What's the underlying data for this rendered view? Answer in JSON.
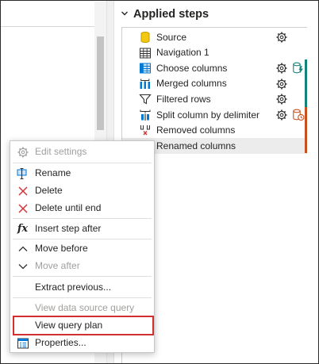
{
  "applied_steps": {
    "title": "Applied steps",
    "steps": [
      {
        "label": "Source"
      },
      {
        "label": "Navigation 1"
      },
      {
        "label": "Choose columns"
      },
      {
        "label": "Merged columns"
      },
      {
        "label": "Filtered rows"
      },
      {
        "label": "Split column by delimiter"
      },
      {
        "label": "Removed columns"
      },
      {
        "label": "Renamed columns"
      }
    ]
  },
  "context_menu": {
    "edit_settings": "Edit settings",
    "rename": "Rename",
    "delete": "Delete",
    "delete_until_end": "Delete until end",
    "insert_step_after": "Insert step after",
    "move_before": "Move before",
    "move_after": "Move after",
    "extract_previous": "Extract previous...",
    "view_data_source_query": "View data source query",
    "view_query_plan": "View query plan",
    "properties": "Properties...",
    "fx_glyph": "fx"
  },
  "colors": {
    "accent_blue": "#0078d4",
    "fold_teal": "#13827a",
    "fold_orange": "#c8501e",
    "highlight_red": "#d32f2f",
    "delete_red": "#d13438"
  }
}
